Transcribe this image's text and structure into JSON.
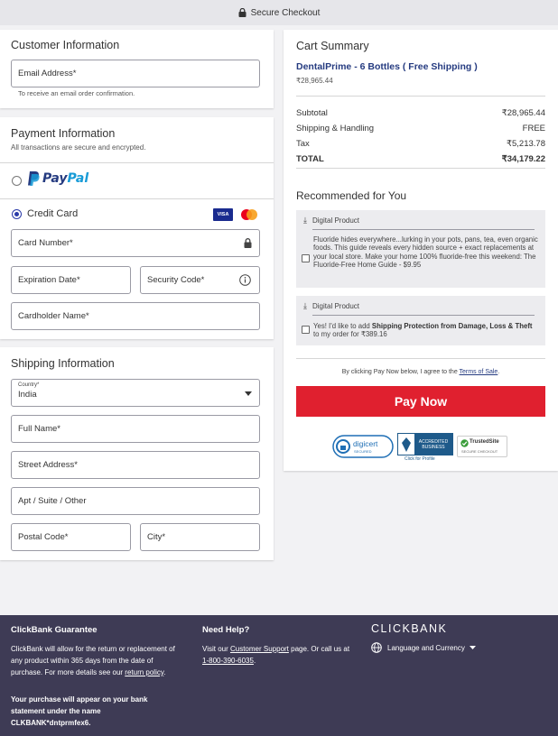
{
  "topbar": {
    "title": "Secure Checkout"
  },
  "customer": {
    "title": "Customer Information",
    "email_label": "Email Address*",
    "email_hint": "To receive an email order confirmation."
  },
  "payment": {
    "title": "Payment Information",
    "subtitle": "All transactions are secure and encrypted.",
    "paypal_pay": "Pay",
    "paypal_pal": "Pal",
    "credit_card_label": "Credit Card",
    "visa_label": "VISA",
    "card_number_label": "Card Number*",
    "expiration_label": "Expiration Date*",
    "security_code_label": "Security Code*",
    "cardholder_label": "Cardholder Name*"
  },
  "shipping": {
    "title": "Shipping Information",
    "country_label": "Country*",
    "country_value": "India",
    "full_name_label": "Full Name*",
    "street_label": "Street Address*",
    "apt_label": "Apt / Suite / Other",
    "postal_label": "Postal Code*",
    "city_label": "City*"
  },
  "cart": {
    "title": "Cart Summary",
    "product_name": "DentalPrime - 6 Bottles ( Free Shipping )",
    "product_price": "₹28,965.44",
    "rows": [
      {
        "label": "Subtotal",
        "value": "₹28,965.44"
      },
      {
        "label": "Shipping & Handling",
        "value": "FREE"
      },
      {
        "label": "Tax",
        "value": "₹5,213.78"
      },
      {
        "label": "TOTAL",
        "value": "₹34,179.22"
      }
    ]
  },
  "recommended": {
    "title": "Recommended for You",
    "items": [
      {
        "tag": "Digital Product",
        "text": "Fluoride hides everywhere...lurking in your pots, pans, tea, even organic foods. This guide reveals every hidden source + exact replacements at your local store. Make your home 100% fluoride-free this weekend: The Fluoride-Free Home Guide - $9.95"
      },
      {
        "tag": "Digital Product",
        "text_before": "Yes! I'd like to add ",
        "text_bold": "Shipping Protection from Damage, Loss & Theft",
        "text_after": " to my order for ₹389.16"
      }
    ]
  },
  "terms": {
    "prefix": "By clicking Pay Now below, I agree to the ",
    "link": "Terms of Sale",
    "suffix": "."
  },
  "pay_now_label": "Pay Now",
  "badges": {
    "digicert": "digicert",
    "digicert_sub": "SECURED",
    "bbb_line1": "ACCREDITED",
    "bbb_line2": "BUSINESS",
    "bbb_click": "Click for Profile",
    "trustedsite": "TrustedSite",
    "trustedsite_sub": "SECURE CHECKOUT"
  },
  "footer": {
    "guarantee_title": "ClickBank Guarantee",
    "guarantee_text_before": "ClickBank will allow for the return or replacement of any product within 365 days from the date of purchase. For more details see our ",
    "guarantee_link": "return policy",
    "guarantee_text_after": ".",
    "statement_text": "Your purchase will appear on your bank statement under the name CLKBANK*dntprmfex6.",
    "help_title": "Need Help?",
    "help_before": "Visit our ",
    "help_link": "Customer Support",
    "help_middle": " page. Or call us at ",
    "help_phone": "1-800-390-6035",
    "help_after": ".",
    "logo": "CLICKBANK",
    "language_label": "Language and Currency"
  }
}
